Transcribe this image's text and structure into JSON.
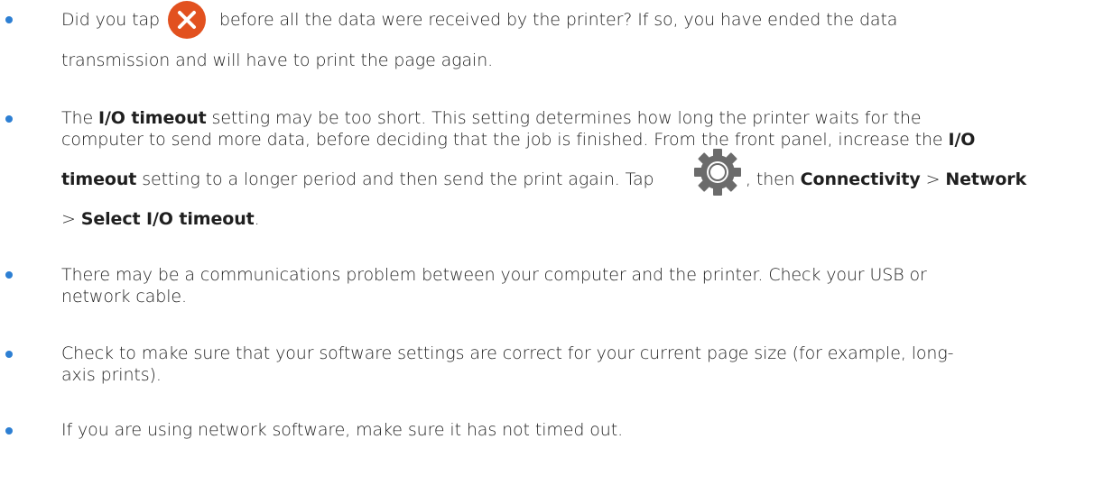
{
  "bullets": [
    {
      "line1_pre": "Did you tap",
      "line1_post": "before all the data were received by the printer? If so, you have ended the data",
      "line2": "transmission and will have to print the page again.",
      "icon": "cancel-icon"
    },
    {
      "line1_a": "The ",
      "line1_term": "I/O timeout",
      "line1_b": " setting may be too short. This setting determines how long the printer waits for the",
      "line2": "computer to send more data, before deciding that the job is finished. From the front panel, increase the ",
      "line2_term": "I/O",
      "line3_term": "timeout",
      "line3_a": " setting to a longer period and then send the print again. Tap ",
      "line3_b": ", then ",
      "line3_term2": "Connectivity",
      "line3_sep": " > ",
      "line3_term3": "Network",
      "line4_sep": "> ",
      "line4_term": "Select I/O timeout",
      "line4_end": ".",
      "icon": "gear-icon"
    },
    {
      "line1": "There may be a communications problem between your computer and the printer. Check your USB or",
      "line2": "network cable."
    },
    {
      "line1": "Check to make sure that your software settings are correct for your current page size (for example, long-",
      "line2": "axis prints)."
    },
    {
      "line1": "If you are using network software, make sure it has not timed out."
    }
  ],
  "colors": {
    "bullet": "#2d7fd3",
    "cancel_icon_fill": "#e2511f",
    "gear_fill": "#6b6b6b",
    "text": "#1f1f1f"
  }
}
